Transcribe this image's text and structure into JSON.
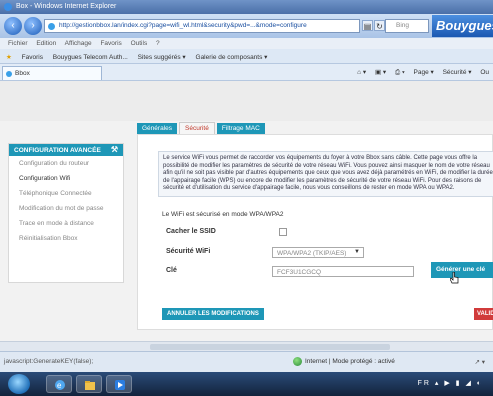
{
  "window": {
    "title": "Box - Windows Internet Explorer"
  },
  "address_bar": {
    "url": "http://gestionbbox.lan/index.cgi?page=wifi_wl.html&security&pwd=...&mode=configure",
    "search_placeholder": "Bing"
  },
  "brand": {
    "text": "Bouygues"
  },
  "menu": {
    "items": [
      "Fichier",
      "Edition",
      "Affichage",
      "Favoris",
      "Outils",
      "?"
    ]
  },
  "favorites": {
    "items": [
      "Favoris",
      "Bouygues Telecom Auth...",
      "Sites suggérés ▾",
      "Galerie de composants ▾"
    ]
  },
  "tab": {
    "label": "Bbox"
  },
  "command_bar": {
    "items": [
      "Page ▾",
      "Sécurité ▾",
      "Ou"
    ]
  },
  "subtabs": [
    "Générales",
    "Sécurité",
    "Filtrage MAC"
  ],
  "sidebar": {
    "title": "CONFIGURATION AVANCÉE",
    "items": [
      "Configuration du routeur",
      "Configuration Wifi",
      "Téléphonique Connectée",
      "Modification du mot de passe",
      "Trace en mode à distance",
      "Réinitialisation Bbox"
    ]
  },
  "info": {
    "text": "Le service WiFi vous permet de raccorder vos équipements du foyer à votre Bbox sans câble. Cette page vous offre la possibilité de modifier les paramètres de sécurité de votre réseau WiFi. Vous pouvez ainsi masquer le nom de votre réseau afin qu'il ne soit pas visible par d'autres équipements que ceux que vous avez déjà paramétrés en WiFi, de modifier la durée de l'appairage facile (WPS) ou encore de modifier les paramètres de sécurité de votre réseau WiFi. Pour des raisons de sécurité et d'utilisation du service d'appairage facile, nous vous conseillons de rester en mode WPA ou WPA2."
  },
  "form": {
    "wpa_title": "Le WiFi est sécurisé en mode WPA/WPA2",
    "hide_ssid_label": "Cacher le SSID",
    "hide_ssid_checked": false,
    "security_label": "Sécurité WiFi",
    "security_value": "WPA/WPA2 (TKIP/AES)",
    "key_label": "Clé",
    "key_value": "FCF3U1CGCQ",
    "generate_button": "Générer une clé",
    "cancel_button": "ANNULER LES MODIFICATIONS",
    "validate_button": "VALIDER"
  },
  "status_bar": {
    "left": "javascript:GenerateKEY(false);",
    "zone": "Internet | Mode protégé : activé",
    "zoom": "↗ ▾"
  },
  "taskbar": {
    "tray": "FR ▴ ▶ ▮ ◢ ◐"
  },
  "colors": {
    "accent": "#1e97b7",
    "danger": "#d13b3b",
    "ie_blue": "#4a6fa8"
  }
}
